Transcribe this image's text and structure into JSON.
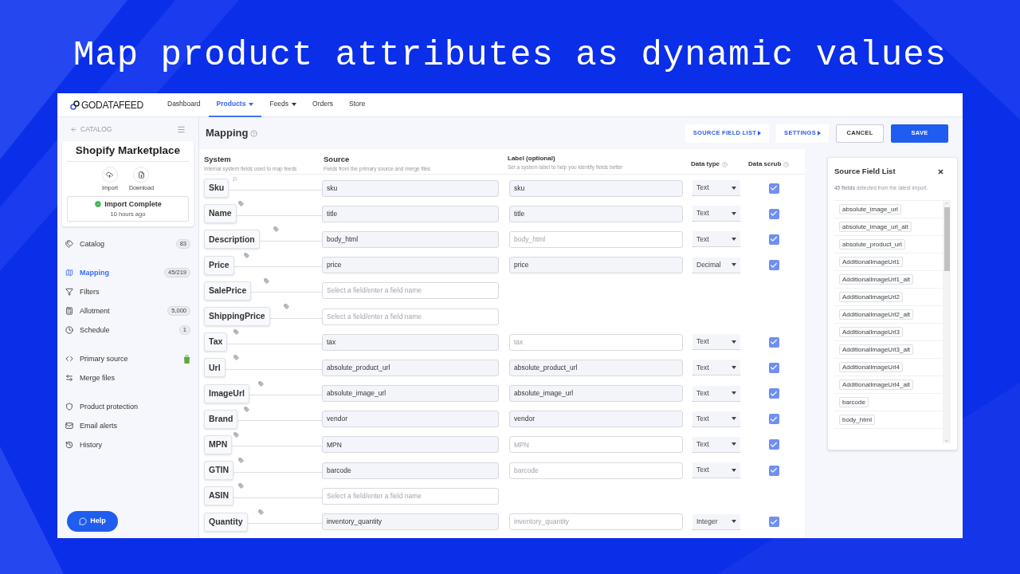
{
  "headline": "Map product attributes as dynamic values",
  "app": {
    "logo": "GODATAFEED",
    "nav": [
      {
        "label": "Dashboard",
        "selected": false,
        "has_menu": false
      },
      {
        "label": "Products",
        "selected": true,
        "has_menu": true
      },
      {
        "label": "Feeds",
        "selected": false,
        "has_menu": true
      },
      {
        "label": "Orders",
        "selected": false,
        "has_menu": false
      },
      {
        "label": "Store",
        "selected": false,
        "has_menu": false
      }
    ],
    "sidebar": {
      "back_link": "CATALOG",
      "store_card": {
        "title": "Shopify Marketplace",
        "actions": [
          "Import",
          "Download"
        ],
        "status": "Import Complete",
        "status_time": "10 hours ago"
      },
      "groups": [
        [
          {
            "label": "Catalog",
            "badge": "83",
            "selected": false
          }
        ],
        [
          {
            "label": "Mapping",
            "badge": "45/219",
            "selected": true
          },
          {
            "label": "Filters",
            "selected": false
          },
          {
            "label": "Allotment",
            "badge": "5,000",
            "selected": false
          },
          {
            "label": "Schedule",
            "badge": "1",
            "selected": false
          }
        ],
        [
          {
            "label": "Primary source",
            "selected": false
          },
          {
            "label": "Merge files",
            "selected": false
          }
        ],
        [
          {
            "label": "Product protection",
            "selected": false
          },
          {
            "label": "Email alerts",
            "selected": false
          },
          {
            "label": "History",
            "selected": false
          }
        ]
      ],
      "help_button": "Help"
    },
    "page_title": "Mapping",
    "toolbar": [
      {
        "label": "SOURCE FIELD LIST",
        "kind": "link"
      },
      {
        "label": "SETTINGS",
        "kind": "link"
      },
      {
        "label": "CANCEL",
        "kind": "outline"
      },
      {
        "label": "SAVE",
        "kind": "primary"
      }
    ],
    "columns": [
      {
        "title": "System",
        "hint": "Internal system fields used to map feeds"
      },
      {
        "title": "Source",
        "hint": "Fields from the primary source and merge files"
      },
      {
        "title": "Label (optional)",
        "hint": "Set a system label to help you identify fields better"
      },
      {
        "title": "Data type"
      },
      {
        "title": "Data scrub"
      }
    ],
    "rows": [
      {
        "system": "Sku",
        "kind": "flagged",
        "source": {
          "value": "sku"
        },
        "label": {
          "value": "sku"
        },
        "data_type": "Text",
        "scrub": true
      },
      {
        "system": "Name",
        "source": {
          "value": "title"
        },
        "label": {
          "value": "title"
        },
        "data_type": "Text",
        "scrub": true
      },
      {
        "system": "Description",
        "source": {
          "value": "body_html"
        },
        "label": {
          "placeholder": "body_html"
        },
        "data_type": "Text",
        "scrub": true
      },
      {
        "system": "Price",
        "source": {
          "value": "price"
        },
        "label": {
          "value": "price"
        },
        "data_type": "Decimal",
        "scrub": true
      },
      {
        "system": "SalePrice",
        "source": {
          "placeholder": "Select a field/enter a field name"
        }
      },
      {
        "system": "ShippingPrice",
        "source": {
          "placeholder": "Select a field/enter a field name"
        }
      },
      {
        "system": "Tax",
        "source": {
          "value": "tax"
        },
        "label": {
          "placeholder": "tax"
        },
        "data_type": "Text",
        "scrub": true
      },
      {
        "system": "Url",
        "source": {
          "value": "absolute_product_url"
        },
        "label": {
          "value": "absolute_product_url"
        },
        "data_type": "Text",
        "scrub": true
      },
      {
        "system": "ImageUrl",
        "source": {
          "value": "absolute_image_url"
        },
        "label": {
          "value": "absolute_image_url"
        },
        "data_type": "Text",
        "scrub": true
      },
      {
        "system": "Brand",
        "source": {
          "value": "vendor"
        },
        "label": {
          "value": "vendor"
        },
        "data_type": "Text",
        "scrub": true
      },
      {
        "system": "MPN",
        "source": {
          "value": "MPN"
        },
        "label": {
          "placeholder": "MPN"
        },
        "data_type": "Text",
        "scrub": true
      },
      {
        "system": "GTIN",
        "source": {
          "value": "barcode"
        },
        "label": {
          "placeholder": "barcode"
        },
        "data_type": "Text",
        "scrub": true
      },
      {
        "system": "ASIN",
        "source": {
          "placeholder": "Select a field/enter a field name"
        }
      },
      {
        "system": "Quantity",
        "source": {
          "value": "inventory_quantity"
        },
        "label": {
          "placeholder": "inventory_quantity"
        },
        "data_type": "Integer",
        "scrub": true
      }
    ],
    "source_panel": {
      "title": "Source Field List",
      "summary": "**45 fields** detected from the latest import.",
      "fields": [
        "absolute_image_url",
        "absolute_image_url_alt",
        "absolute_product_url",
        "AdditionalImageUrl1",
        "AdditionalImageUrl1_alt",
        "AdditionalImageUrl2",
        "AdditionalImageUrl2_alt",
        "AdditionalImageUrl3",
        "AdditionalImageUrl3_alt",
        "AdditionalImageUrl4",
        "AdditionalImageUrl4_alt",
        "barcode",
        "body_html"
      ]
    }
  }
}
